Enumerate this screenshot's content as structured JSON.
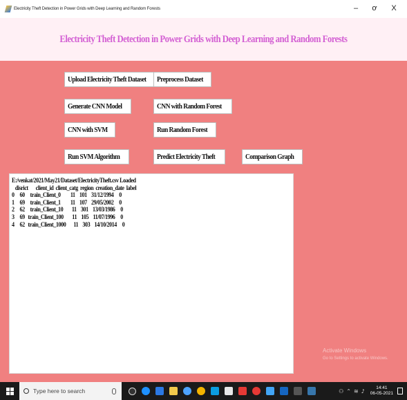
{
  "window": {
    "title": "Electricity Theft Detection in Power Grids with Deep Learning and Random Forests",
    "minimize_glyph": "–",
    "maximize_glyph": "ơ",
    "close_glyph": "X"
  },
  "header": {
    "heading": "Electricity Theft Detection in Power Grids with Deep Learning and Random Forests",
    "heading_color": "#d35fd3"
  },
  "buttons": {
    "upload": "Upload Electricity Theft Dataset",
    "preprocess": "Preprocess Dataset",
    "cnn": "Generate CNN Model",
    "cnn_rf": "CNN with Random Forest",
    "cnn_svm": "CNN with SVM",
    "rf": "Run Random Forest",
    "svm": "Run SVM Algorithm",
    "predict": "Predict Electricity Theft",
    "graph": "Comparison Graph"
  },
  "output": {
    "lines": [
      "E:/venkat/2021/May21/Dataset/ElectricityTheft.csv Loaded",
      "   disrict       client_id  client_catg  region  creation_date  label",
      "0     60     train_Client_0         11    101    31/12/1994     0",
      "1     69     train_Client_1         11    107    29/05/2002     0",
      "2     62     train_Client_10        11    301    13/03/1986     0",
      "3     69   train_Client_100        11    105    11/07/1996     0",
      "4     62   train_Client_1000       11    303    14/10/2014     0"
    ]
  },
  "watermark": {
    "line1": "Activate Windows",
    "line2": "Go to Settings to activate Windows."
  },
  "taskbar": {
    "search_placeholder": "Type here to search",
    "time": "14:41",
    "date": "06-05-2021"
  },
  "colors": {
    "background": "#f08080",
    "header_bg": "#fff0f5",
    "taskbar_bg": "#1a1a1a"
  }
}
